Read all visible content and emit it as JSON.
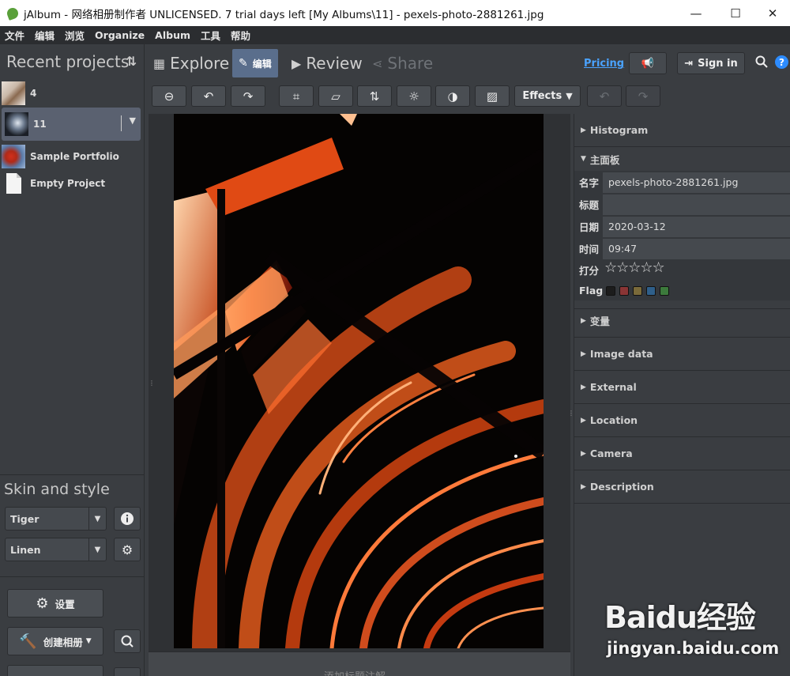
{
  "window": {
    "title": "jAlbum - 网络相册制作者 UNLICENSED. 7 trial days left [My Albums\\11] - pexels-photo-2881261.jpg",
    "minimize": "—",
    "maximize": "☐",
    "close": "✕"
  },
  "menu": [
    "文件",
    "编辑",
    "浏览",
    "Organize",
    "Album",
    "工具",
    "帮助"
  ],
  "left": {
    "recent_title": "Recent projects",
    "sort_icon": "⇅",
    "projects": [
      {
        "name": "4",
        "selected": false
      },
      {
        "name": "11",
        "selected": true
      },
      {
        "name": "Sample Portfolio",
        "selected": false
      },
      {
        "name": "Empty Project",
        "selected": false
      }
    ],
    "skin_title": "Skin and style",
    "skin": "Tiger",
    "style": "Linen",
    "settings_label": "设置",
    "create_album_label": "创建相册"
  },
  "tabs": [
    {
      "label": "Explore",
      "icon": "grid-icon"
    },
    {
      "label": "编辑",
      "icon": "pencil-icon",
      "active": true
    },
    {
      "label": "Review",
      "icon": "play-icon"
    },
    {
      "label": "Share",
      "icon": "share-icon",
      "dim": true
    }
  ],
  "header": {
    "pricing": "Pricing",
    "sign_in": "Sign in"
  },
  "toolbar": {
    "effects_label": "Effects"
  },
  "right": {
    "sections_top": [
      {
        "label": "Histogram"
      }
    ],
    "main_panel_label": "主面板",
    "fields": [
      {
        "label": "名字",
        "value": "pexels-photo-2881261.jpg"
      },
      {
        "label": "标题",
        "value": ""
      },
      {
        "label": "日期",
        "value": "2020-03-12"
      },
      {
        "label": "时间",
        "value": "09:47"
      }
    ],
    "rating_label": "打分",
    "rating_stars": "☆☆☆☆☆",
    "flag_label": "Flag",
    "flag_colors": [
      "#1c1c1c",
      "#8a3535",
      "#7a6a3a",
      "#2f5f8a",
      "#3c7a3c"
    ],
    "sections_bottom": [
      {
        "label": "变量"
      },
      {
        "label": "Image data"
      },
      {
        "label": "External"
      },
      {
        "label": "Location"
      },
      {
        "label": "Camera"
      },
      {
        "label": "Description"
      }
    ]
  },
  "bottom_strip_text": "添加标题注解",
  "watermark": {
    "brand": "Baidu经验",
    "url": "jingyan.baidu.com"
  }
}
